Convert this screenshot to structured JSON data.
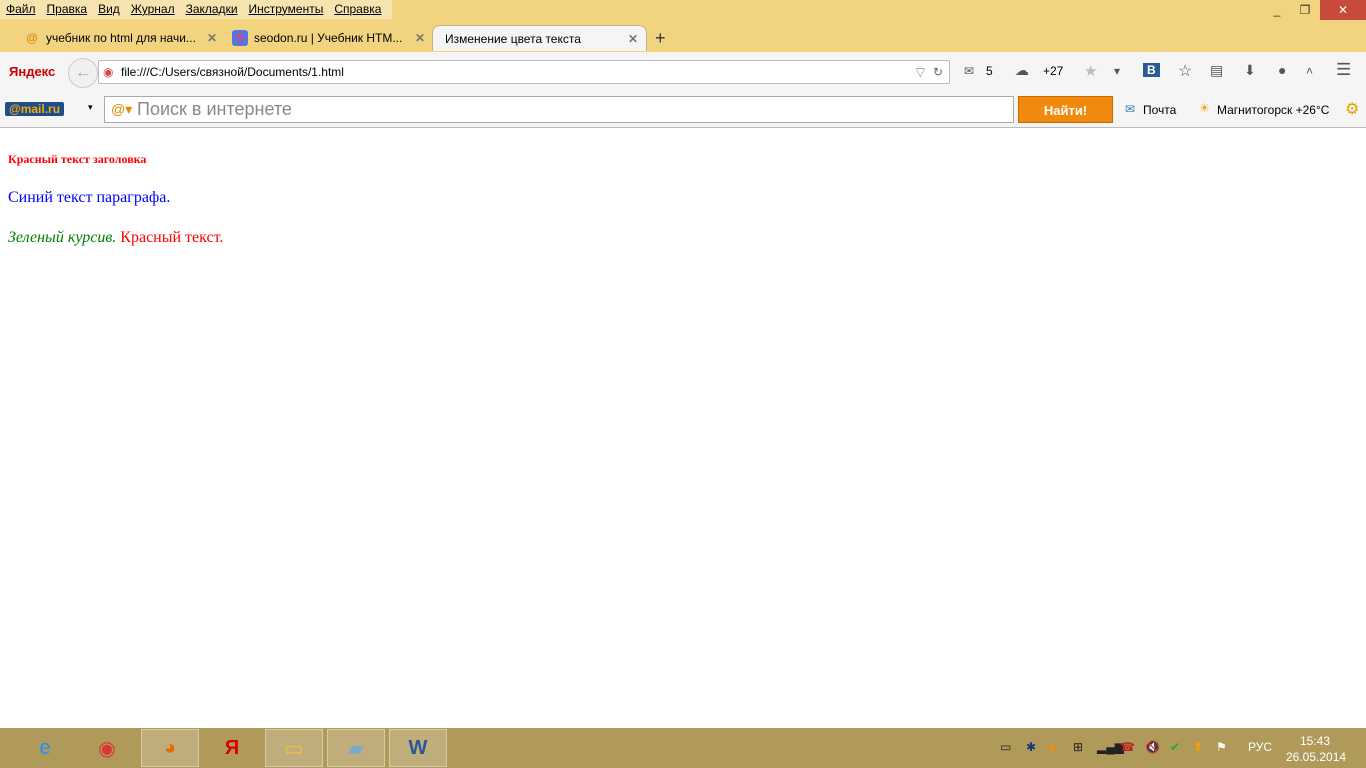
{
  "menu": [
    "Файл",
    "Правка",
    "Вид",
    "Журнал",
    "Закладки",
    "Инструменты",
    "Справка"
  ],
  "tabs": [
    {
      "title": "учебник по html для начи...",
      "icon": "mail-search-icon"
    },
    {
      "title": "seodon.ru | Учебник HTM...",
      "icon": "seodon-icon",
      "glyph": "S"
    },
    {
      "title": "Изменение цвета текста",
      "icon": "page-icon"
    }
  ],
  "window": {
    "minimize": "_",
    "restore": "❐",
    "close": "✕"
  },
  "new_tab": "+",
  "nav": {
    "brand": "Яндекс",
    "url": "file:///C:/Users/связной/Documents/1.html",
    "mail_count": "5",
    "weather": "+27",
    "vk": "В"
  },
  "mailru": {
    "logo": "@mail.ru",
    "search_placeholder": "Поиск в интернете",
    "find": "Найти!",
    "mail": "Почта",
    "weather": "Магнитогорск +26°C"
  },
  "page": {
    "heading": "Красный текст заголовка",
    "paragraph": "Синий текст параграфа.",
    "italic_green": "Зеленый курсив.",
    "red_text": "Красный текст."
  },
  "colors": {
    "heading": "#ff0000",
    "paragraph": "#0000ff",
    "green": "#008000"
  },
  "taskbar": {
    "lang": "РУС",
    "time": "15:43",
    "date": "26.05.2014"
  }
}
